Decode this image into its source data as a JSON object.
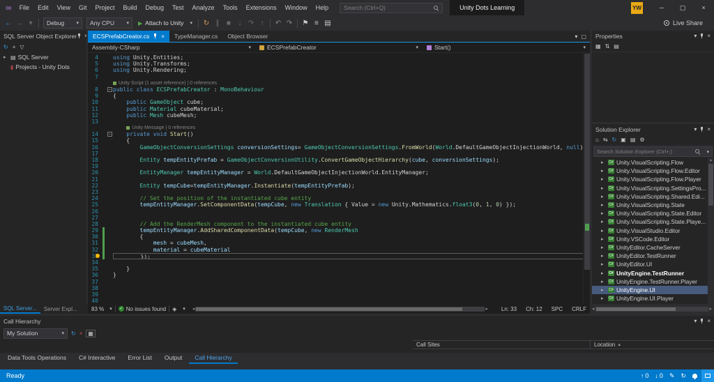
{
  "colors": {
    "accent": "#007acc",
    "sel": "#475b7d",
    "chg": "#4f9e4f",
    "avatar": "#e9a915"
  },
  "glyphs": {
    "logo": "∞",
    "chevron_down": "▾",
    "chevron_right": "▸",
    "close": "×",
    "play": "▶",
    "check": "✓",
    "scroll_left": "◂",
    "scroll_right": "▸",
    "scroll_up": "▴",
    "scroll_down": "▾",
    "sort_asc": "▲",
    "up_arrow": "↑",
    "down_arrow": "↓",
    "pencil": "✎",
    "sync": "↻",
    "diamond": "◈"
  },
  "title_bar": {
    "menus": [
      "File",
      "Edit",
      "View",
      "Git",
      "Project",
      "Build",
      "Debug",
      "Test",
      "Analyze",
      "Tools",
      "Extensions",
      "Window",
      "Help"
    ],
    "search_placeholder": "Search (Ctrl+Q)",
    "solution_name": "Unity Dots Learning",
    "avatar_initials": "YW",
    "window_buttons": [
      {
        "name": "minimize-button",
        "g": "─"
      },
      {
        "name": "maximize-button",
        "g": "▢"
      },
      {
        "name": "close-button",
        "g": "×"
      }
    ]
  },
  "toolbar": {
    "items": [
      {
        "k": "icon",
        "name": "navigate-backward-icon",
        "g": "←",
        "c": "#3b9ae1"
      },
      {
        "k": "icon",
        "name": "navigate-forward-icon",
        "g": "→",
        "c": "#6a6a6a"
      },
      {
        "k": "icon",
        "name": "navigation-chevron-icon",
        "g": "▾",
        "c": "#6a6a6a"
      },
      {
        "k": "sep"
      },
      {
        "k": "combo",
        "name": "configuration-dropdown",
        "label": "Debug",
        "w": 56
      },
      {
        "k": "combo",
        "name": "platform-dropdown",
        "label": "Any CPU",
        "w": 66
      },
      {
        "k": "attach",
        "name": "attach-to-unity-button",
        "label": "Attach to Unity"
      },
      {
        "k": "sep"
      },
      {
        "k": "icon",
        "name": "hot-reload-icon",
        "g": "↻",
        "c": "#d69d56"
      },
      {
        "k": "icon",
        "name": "pause-icon",
        "g": "∥",
        "c": "#6a6a6a"
      },
      {
        "k": "icon",
        "name": "stop-icon",
        "g": "■",
        "c": "#6a6a6a"
      },
      {
        "k": "icon",
        "name": "step-into-icon",
        "g": "↓",
        "c": "#6a6a6a"
      },
      {
        "k": "icon",
        "name": "step-over-icon",
        "g": "↷",
        "c": "#6a6a6a"
      },
      {
        "k": "icon",
        "name": "step-out-icon",
        "g": "↑",
        "c": "#6a6a6a"
      },
      {
        "k": "sep"
      },
      {
        "k": "icon",
        "name": "undo-icon",
        "g": "↶",
        "c": "#8a8a8e"
      },
      {
        "k": "icon",
        "name": "redo-icon",
        "g": "↷",
        "c": "#8a8a8e"
      },
      {
        "k": "sep"
      },
      {
        "k": "icon",
        "name": "bookmark-icon",
        "g": "⚑",
        "c": "#c8c8c8"
      },
      {
        "k": "icon",
        "name": "indent-icon",
        "g": "≡",
        "c": "#c8c8c8"
      },
      {
        "k": "icon",
        "name": "comment-icon",
        "g": "▤",
        "c": "#c8c8c8"
      }
    ],
    "live_share": "Live Share"
  },
  "left_panel": {
    "title": "SQL Server Object Explorer",
    "toolbar_icons": [
      {
        "name": "refresh-icon",
        "g": "↻",
        "c": "#3b9ae1"
      },
      {
        "name": "add-sql-server-icon",
        "g": "+",
        "c": "#c8c8c8"
      },
      {
        "name": "filter-icon",
        "g": "▽",
        "c": "#c8c8c8"
      }
    ],
    "items": [
      {
        "label": "SQL Server",
        "icon": "sql-server-icon",
        "g": "▤",
        "c": "#c8c8c8",
        "chev": true
      },
      {
        "label": "Projects - Unity Dots",
        "icon": "projects-folder-icon",
        "g": "▮",
        "c": "#a54242",
        "chev": false
      }
    ],
    "bottom_tabs": [
      {
        "label": "SQL Server...",
        "active": true
      },
      {
        "label": "Server Expl..."
      }
    ]
  },
  "editor": {
    "tabs": [
      {
        "label": "ECSPrefabCreator.cs",
        "active": true
      },
      {
        "label": "TypeManager.cs"
      },
      {
        "label": "Object Browser"
      }
    ],
    "navbar": {
      "project": "Assembly-CSharp",
      "type": "ECSPrefabCreator",
      "member": "Start()"
    },
    "code": [
      {
        "n": 4,
        "t": [
          [
            "kw",
            "using"
          ],
          [
            "pl",
            " Unity.Entities;"
          ]
        ]
      },
      {
        "n": 5,
        "t": [
          [
            "kw",
            "using"
          ],
          [
            "pl",
            " Unity.Transforms;"
          ]
        ]
      },
      {
        "n": 6,
        "t": [
          [
            "kw",
            "using"
          ],
          [
            "pl",
            " Unity.Rendering;"
          ]
        ]
      },
      {
        "n": 7,
        "t": []
      },
      {
        "lens": "Unity Script (1 asset reference) | 0 references",
        "ind": 0
      },
      {
        "n": 8,
        "fold": true,
        "t": [
          [
            "kw",
            "public class "
          ],
          [
            "ty",
            "ECSPrefabCreator"
          ],
          [
            "pl",
            " : "
          ],
          [
            "ty",
            "MonoBehaviour"
          ]
        ]
      },
      {
        "n": 9,
        "t": [
          [
            "pl",
            "{"
          ]
        ]
      },
      {
        "n": 10,
        "t": [
          [
            "pl",
            "    "
          ],
          [
            "kw",
            "public "
          ],
          [
            "ty",
            "GameObject"
          ],
          [
            "pl",
            " cube;"
          ]
        ]
      },
      {
        "n": 11,
        "t": [
          [
            "pl",
            "    "
          ],
          [
            "kw",
            "public "
          ],
          [
            "ty",
            "Material"
          ],
          [
            "pl",
            " cubeMaterial;"
          ]
        ]
      },
      {
        "n": 12,
        "t": [
          [
            "pl",
            "    "
          ],
          [
            "kw",
            "public "
          ],
          [
            "ty",
            "Mesh"
          ],
          [
            "pl",
            " cubeMesh;"
          ]
        ]
      },
      {
        "n": 13,
        "t": []
      },
      {
        "lens": "Unity Message | 0 references",
        "ind": 4
      },
      {
        "n": 14,
        "fold": true,
        "t": [
          [
            "pl",
            "    "
          ],
          [
            "kw",
            "private void "
          ],
          [
            "me",
            "Start"
          ],
          [
            "pl",
            "()"
          ]
        ]
      },
      {
        "n": 15,
        "t": [
          [
            "pl",
            "    {"
          ]
        ]
      },
      {
        "n": 16,
        "t": [
          [
            "pl",
            "        "
          ],
          [
            "ty",
            "GameObjectConversionSettings"
          ],
          [
            "pl",
            " "
          ],
          [
            "va",
            "conversionSettings"
          ],
          [
            "pl",
            "= "
          ],
          [
            "ty",
            "GameObjectConversionSettings"
          ],
          [
            "pl",
            "."
          ],
          [
            "me",
            "FromWorld"
          ],
          [
            "pl",
            "("
          ],
          [
            "ty",
            "World"
          ],
          [
            "pl",
            ".DefaultGameObjectInjectionWorld, "
          ],
          [
            "kw",
            "null"
          ],
          [
            "pl",
            ");"
          ]
        ]
      },
      {
        "n": 17,
        "t": []
      },
      {
        "n": 18,
        "t": [
          [
            "pl",
            "        "
          ],
          [
            "ty",
            "Entity"
          ],
          [
            "pl",
            " "
          ],
          [
            "va",
            "tempEntityPrefab"
          ],
          [
            "pl",
            " = "
          ],
          [
            "ty",
            "GameObjectConversionUtility"
          ],
          [
            "pl",
            "."
          ],
          [
            "me",
            "ConvertGameObjectHierarchy"
          ],
          [
            "pl",
            "("
          ],
          [
            "va",
            "cube"
          ],
          [
            "pl",
            ", "
          ],
          [
            "va",
            "conversionSettings"
          ],
          [
            "pl",
            ");"
          ]
        ]
      },
      {
        "n": 19,
        "t": []
      },
      {
        "n": 20,
        "t": [
          [
            "pl",
            "        "
          ],
          [
            "ty",
            "EntityManager"
          ],
          [
            "pl",
            " "
          ],
          [
            "va",
            "tempEntityManager"
          ],
          [
            "pl",
            " = "
          ],
          [
            "ty",
            "World"
          ],
          [
            "pl",
            ".DefaultGameObjectInjectionWorld.EntityManager;"
          ]
        ]
      },
      {
        "n": 21,
        "t": []
      },
      {
        "n": 22,
        "t": [
          [
            "pl",
            "        "
          ],
          [
            "ty",
            "Entity"
          ],
          [
            "pl",
            " "
          ],
          [
            "va",
            "tempCube"
          ],
          [
            "pl",
            "="
          ],
          [
            "va",
            "tempEntityManager"
          ],
          [
            "pl",
            "."
          ],
          [
            "me",
            "Instantiate"
          ],
          [
            "pl",
            "("
          ],
          [
            "va",
            "tempEntityPrefab"
          ],
          [
            "pl",
            ");"
          ]
        ]
      },
      {
        "n": 23,
        "t": []
      },
      {
        "n": 24,
        "t": [
          [
            "pl",
            "        "
          ],
          [
            "cm",
            "// Set the position of the instantiated cube entity"
          ]
        ]
      },
      {
        "n": 25,
        "t": [
          [
            "pl",
            "        "
          ],
          [
            "va",
            "tempEntityManager"
          ],
          [
            "pl",
            "."
          ],
          [
            "me",
            "SetComponentData"
          ],
          [
            "pl",
            "("
          ],
          [
            "va",
            "tempCube"
          ],
          [
            "pl",
            ", "
          ],
          [
            "kw",
            "new"
          ],
          [
            "pl",
            " "
          ],
          [
            "ty",
            "Translation"
          ],
          [
            "pl",
            " { Value = "
          ],
          [
            "kw",
            "new"
          ],
          [
            "pl",
            " Unity.Mathematics."
          ],
          [
            "ty",
            "float3"
          ],
          [
            "pl",
            "("
          ],
          [
            "nu",
            "0"
          ],
          [
            "pl",
            ", "
          ],
          [
            "nu",
            "1"
          ],
          [
            "pl",
            ", "
          ],
          [
            "nu",
            "0"
          ],
          [
            "pl",
            ") });"
          ]
        ]
      },
      {
        "n": 26,
        "t": []
      },
      {
        "n": 27,
        "t": []
      },
      {
        "n": 28,
        "t": [
          [
            "pl",
            "        "
          ],
          [
            "cm",
            "// Add the RenderMesh component to the instantiated cube entity"
          ]
        ]
      },
      {
        "n": 29,
        "chg": true,
        "t": [
          [
            "pl",
            "        "
          ],
          [
            "va",
            "tempEntityManager"
          ],
          [
            "pl",
            "."
          ],
          [
            "me",
            "AddSharedComponentData"
          ],
          [
            "pl",
            "("
          ],
          [
            "va",
            "tempCube"
          ],
          [
            "pl",
            ", "
          ],
          [
            "kw",
            "new"
          ],
          [
            "pl",
            " "
          ],
          [
            "ty",
            "RenderMesh"
          ]
        ]
      },
      {
        "n": 30,
        "chg": true,
        "t": [
          [
            "pl",
            "        {"
          ]
        ]
      },
      {
        "n": 31,
        "chg": true,
        "t": [
          [
            "pl",
            "            "
          ],
          [
            "va",
            "mesh"
          ],
          [
            "pl",
            " = "
          ],
          [
            "va",
            "cubeMesh"
          ],
          [
            "pl",
            ","
          ]
        ]
      },
      {
        "n": 32,
        "chg": true,
        "t": [
          [
            "pl",
            "            "
          ],
          [
            "va",
            "material"
          ],
          [
            "pl",
            " = "
          ],
          [
            "va",
            "cubeMaterial"
          ]
        ]
      },
      {
        "n": 33,
        "cur": true,
        "bulb": true,
        "chg": true,
        "t": [
          [
            "pl",
            "        });"
          ]
        ]
      },
      {
        "n": 34,
        "t": []
      },
      {
        "n": 35,
        "t": [
          [
            "pl",
            "    }"
          ]
        ]
      },
      {
        "n": 36,
        "t": [
          [
            "pl",
            "}"
          ]
        ]
      },
      {
        "n": 37,
        "t": []
      },
      {
        "n": 38,
        "t": []
      },
      {
        "n": 39,
        "t": []
      },
      {
        "n": 40,
        "t": []
      }
    ],
    "status": {
      "zoom": "83 %",
      "issues": "No issues found",
      "ln": "Ln: 33",
      "ch": "Ch: 12",
      "spc": "SPC",
      "eol": "CRLF"
    }
  },
  "properties_panel": {
    "title": "Properties",
    "toolbar_icons": [
      {
        "name": "categorized-icon",
        "g": "▦",
        "c": "#c8c8c8"
      },
      {
        "name": "alphabetical-icon",
        "g": "⇅",
        "c": "#c8c8c8"
      },
      {
        "name": "property-pages-icon",
        "g": "▤",
        "c": "#c8c8c8"
      }
    ]
  },
  "solution_explorer": {
    "title": "Solution Explorer",
    "search_placeholder": "Search Solution Explorer (Ctrl+;)",
    "project_icon": "C#",
    "toolbar_icons": [
      {
        "name": "home-icon",
        "g": "⌂",
        "c": "#c8c8c8"
      },
      {
        "name": "switch-views-icon",
        "g": "⇆",
        "c": "#c8c8c8"
      },
      {
        "name": "sync-with-active-document-icon",
        "g": "↻",
        "c": "#3b9ae1"
      },
      {
        "name": "collapse-all-icon",
        "g": "▣",
        "c": "#c8c8c8"
      },
      {
        "name": "show-all-files-icon",
        "g": "▤",
        "c": "#c8c8c8"
      },
      {
        "name": "properties-icon",
        "g": "⚙",
        "c": "#c8c8c8"
      }
    ],
    "items": [
      {
        "label": "Unity.VisualScripting.Flow"
      },
      {
        "label": "Unity.VisualScripting.Flow.Editor"
      },
      {
        "label": "Unity.VisualScripting.Flow.Player"
      },
      {
        "label": "Unity.VisualScripting.SettingsPro..."
      },
      {
        "label": "Unity.VisualScripting.Shared.Edi..."
      },
      {
        "label": "Unity.VisualScripting.State"
      },
      {
        "label": "Unity.VisualScripting.State.Editor"
      },
      {
        "label": "Unity.VisualScripting.State.Playe..."
      },
      {
        "label": "Unity.VisualStudio.Editor"
      },
      {
        "label": "Unity.VSCode.Editor"
      },
      {
        "label": "UnityEditor.CacheServer"
      },
      {
        "label": "UnityEditor.TestRunner"
      },
      {
        "label": "UnityEditor.UI"
      },
      {
        "label": "UnityEngine.TestRunner",
        "bold": true
      },
      {
        "label": "UnityEngine.TestRunner.Player"
      },
      {
        "label": "UnityEngine.UI",
        "selected": true
      },
      {
        "label": "UnityEngine.UI.Player"
      }
    ]
  },
  "call_hierarchy": {
    "title": "Call Hierarchy",
    "scope": "My Solution",
    "col_call_sites": "Call Sites",
    "col_location": "Location",
    "icons": [
      {
        "name": "refresh-icon",
        "g": "↻",
        "c": "#3b9ae1"
      },
      {
        "name": "remove-root-icon",
        "g": "×",
        "c": "#c75050"
      },
      {
        "name": "toggle-details-icon",
        "g": "▦",
        "c": "#c8c8c8",
        "boxed": true
      }
    ]
  },
  "panel_tabs": [
    {
      "label": "Data Tools Operations"
    },
    {
      "label": "C# Interactive"
    },
    {
      "label": "Error List"
    },
    {
      "label": "Output"
    },
    {
      "label": "Call Hierarchy",
      "active": true
    }
  ],
  "status_bar": {
    "ready": "Ready",
    "ahead": "0",
    "behind": "0"
  }
}
